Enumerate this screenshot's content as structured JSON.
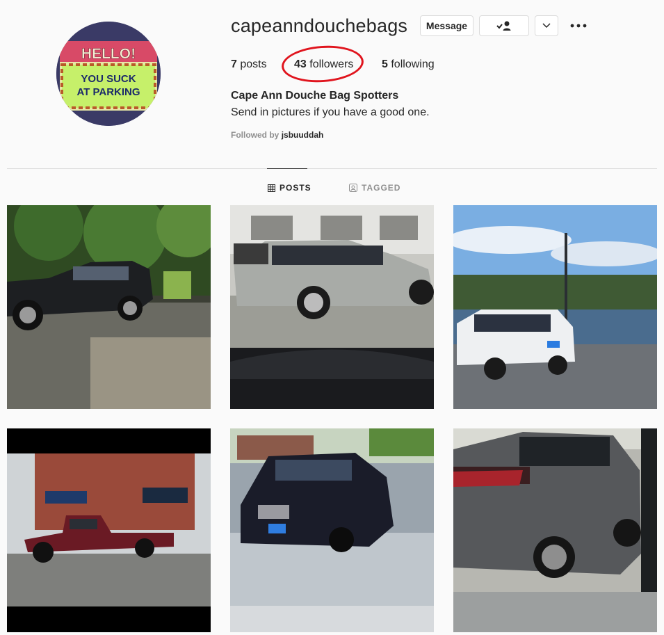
{
  "profile": {
    "username": "capeanndouchebags",
    "avatar_text": {
      "line1": "HELLO!",
      "line2": "YOU SUCK",
      "line3": "AT PARKING"
    },
    "full_name": "Cape Ann Douche Bag Spotters",
    "bio": "Send in pictures if you have a good one.",
    "followed_by_prefix": "Followed by",
    "followed_by_user": "jsbuuddah"
  },
  "actions": {
    "message_label": "Message",
    "follow_icon": "person-check-icon",
    "dropdown_icon": "chevron-down-icon",
    "more_icon": "more-options-icon"
  },
  "stats": {
    "posts_count": "7",
    "posts_label": "posts",
    "followers_count": "43",
    "followers_label": "followers",
    "following_count": "5",
    "following_label": "following"
  },
  "tabs": {
    "posts": "POSTS",
    "tagged": "TAGGED"
  },
  "colors": {
    "annotation": "#e0141d",
    "border": "#dbdbdb",
    "muted": "#8e8e8e"
  }
}
